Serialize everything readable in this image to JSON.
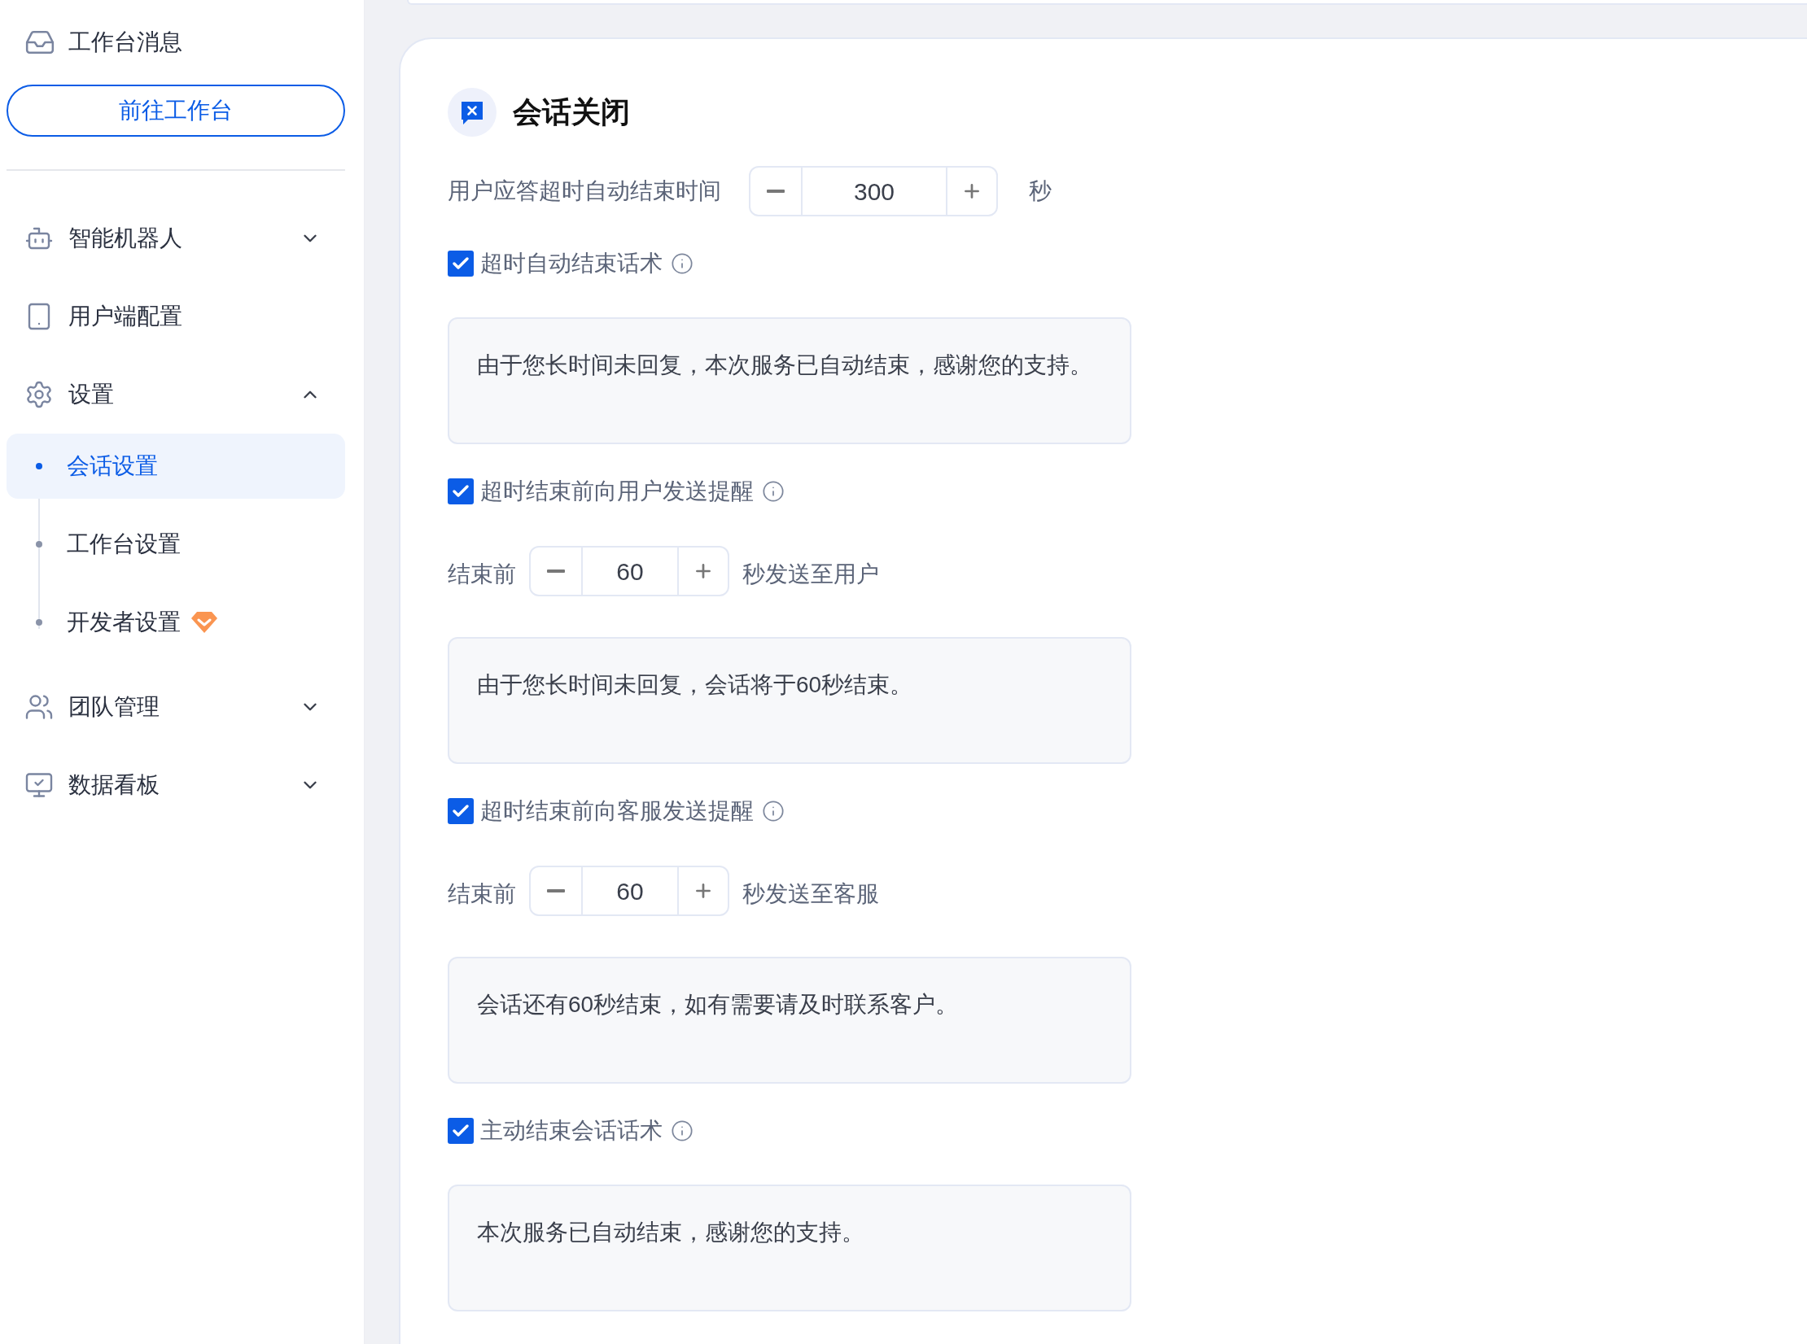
{
  "sidebar": {
    "header": {
      "label": "工作台消息"
    },
    "goto_button": {
      "label": "前往工作台"
    },
    "items": [
      {
        "label": "智能机器人",
        "expanded": false
      },
      {
        "label": "用户端配置"
      },
      {
        "label": "设置",
        "expanded": true,
        "children": [
          {
            "label": "会话设置",
            "selected": true,
            "premium": false
          },
          {
            "label": "工作台设置",
            "selected": false,
            "premium": false
          },
          {
            "label": "开发者设置",
            "selected": false,
            "premium": true
          }
        ]
      },
      {
        "label": "团队管理",
        "expanded": false
      },
      {
        "label": "数据看板",
        "expanded": false
      }
    ]
  },
  "card": {
    "title": "会话关闭",
    "timeout": {
      "label": "用户应答超时自动结束时间",
      "value": "300",
      "unit": "秒"
    },
    "fields": [
      {
        "kind": "checkbox",
        "label": "超时自动结束话术",
        "checked": true
      },
      {
        "kind": "message",
        "text": "由于您长时间未回复，本次服务已自动结束，感谢您的支持。"
      },
      {
        "kind": "checkbox",
        "label": "超时结束前向用户发送提醒",
        "checked": true
      },
      {
        "kind": "stepper",
        "prefix": "结束前",
        "value": "60",
        "suffix": "秒发送至用户"
      },
      {
        "kind": "message",
        "text": "由于您长时间未回复，会话将于60秒结束。"
      },
      {
        "kind": "checkbox",
        "label": "超时结束前向客服发送提醒",
        "checked": true
      },
      {
        "kind": "stepper",
        "prefix": "结束前",
        "value": "60",
        "suffix": "秒发送至客服"
      },
      {
        "kind": "message",
        "text": "会话还有60秒结束，如有需要请及时联系客户。"
      },
      {
        "kind": "checkbox",
        "label": "主动结束会话话术",
        "checked": true
      },
      {
        "kind": "message",
        "text": "本次服务已自动结束，感谢您的支持。"
      }
    ]
  }
}
